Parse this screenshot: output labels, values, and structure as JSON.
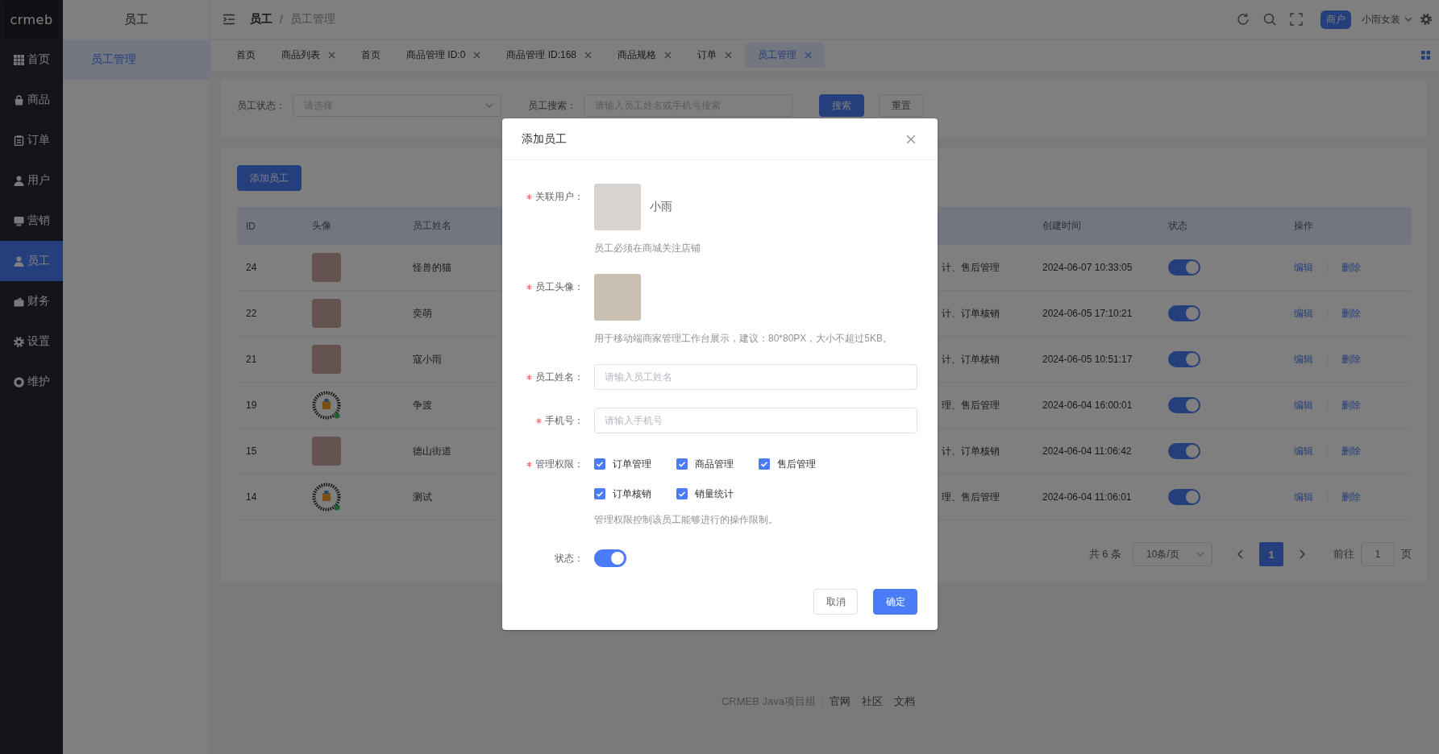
{
  "sidebar": {
    "logo": "crmeb",
    "items": [
      {
        "label": "首页",
        "selected": false
      },
      {
        "label": "商品",
        "selected": false
      },
      {
        "label": "订单",
        "selected": false
      },
      {
        "label": "用户",
        "selected": false
      },
      {
        "label": "营销",
        "selected": false
      },
      {
        "label": "员工",
        "selected": true
      },
      {
        "label": "财务",
        "selected": false
      },
      {
        "label": "设置",
        "selected": false
      },
      {
        "label": "维护",
        "selected": false
      }
    ]
  },
  "submenu": {
    "title": "员工",
    "items": [
      {
        "label": "员工管理",
        "selected": true
      }
    ]
  },
  "header": {
    "breadcrumb": [
      "员工",
      "员工管理"
    ],
    "separator": "/",
    "badge": "商户",
    "user": "小雨女装"
  },
  "tabs": [
    {
      "label": "首页",
      "closable": false,
      "selected": false
    },
    {
      "label": "商品列表",
      "closable": true,
      "selected": false
    },
    {
      "label": "首页",
      "closable": false,
      "selected": false
    },
    {
      "label": "商品管理 ID:0",
      "closable": true,
      "selected": false
    },
    {
      "label": "商品管理 ID:168",
      "closable": true,
      "selected": false
    },
    {
      "label": "商品规格",
      "closable": true,
      "selected": false
    },
    {
      "label": "订单",
      "closable": true,
      "selected": false
    },
    {
      "label": "员工管理",
      "closable": true,
      "selected": true
    }
  ],
  "filter": {
    "fields": [
      {
        "kind": "select",
        "label": "员工状态：",
        "placeholder": "请选择"
      },
      {
        "kind": "input",
        "label": "员工搜索：",
        "placeholder": "请输入员工姓名或手机号搜索"
      }
    ],
    "buttons": [
      {
        "kind": "primary",
        "label": "搜索"
      },
      {
        "kind": "plain",
        "label": "重置"
      }
    ]
  },
  "table": {
    "add_button": "添加员工",
    "columns": [
      "ID",
      "头像",
      "员工姓名",
      "创建时间",
      "状态",
      "操作"
    ],
    "rows": [
      {
        "id": "24",
        "avatar": {
          "kind": "photo"
        },
        "name": "怪兽的猫",
        "column_4": "计、售后管理",
        "created": "2024-06-07 10:33:05",
        "on": true,
        "actions": [
          "编辑",
          "删除"
        ]
      },
      {
        "id": "22",
        "avatar": {
          "kind": "photo"
        },
        "name": "奕萌",
        "column_4": "计、订单核销",
        "created": "2024-06-05 17:10:21",
        "on": true,
        "actions": [
          "编辑",
          "删除"
        ]
      },
      {
        "id": "21",
        "avatar": {
          "kind": "photo"
        },
        "name": "寇小雨",
        "column_4": "计、订单核销",
        "created": "2024-06-05 10:51:17",
        "on": true,
        "actions": [
          "编辑",
          "删除"
        ]
      },
      {
        "id": "19",
        "avatar": {
          "kind": "code"
        },
        "name": "争渡",
        "column_4": "理、售后管理",
        "created": "2024-06-04 16:00:01",
        "on": true,
        "actions": [
          "编辑",
          "删除"
        ]
      },
      {
        "id": "15",
        "avatar": {
          "kind": "photo"
        },
        "name": "德山街道",
        "column_4": "计、订单核销",
        "created": "2024-06-04 11:06:42",
        "on": true,
        "actions": [
          "编辑",
          "删除"
        ]
      },
      {
        "id": "14",
        "avatar": {
          "kind": "code"
        },
        "name": "测试",
        "column_4": "理、售后管理",
        "created": "2024-06-04 11:06:01",
        "on": true,
        "actions": [
          "编辑",
          "删除"
        ]
      }
    ]
  },
  "pagination": {
    "total": "共 6 条",
    "page_size": "10条/页",
    "pages": [
      {
        "label": "1",
        "selected": true
      }
    ],
    "goto_label": "前往",
    "goto_value": "1",
    "goto_suffix": "页"
  },
  "footer": {
    "text": "CRMEB Java项目组",
    "links": [
      "官网",
      "社区",
      "文档"
    ]
  },
  "dialog": {
    "title": "添加员工",
    "fields": [
      {
        "kind": "user",
        "label": "关联用户：",
        "required": true,
        "name": "小雨",
        "help": "员工必须在商城关注店铺"
      },
      {
        "kind": "image",
        "label": "员工头像：",
        "required": true,
        "help": "用于移动端商家管理工作台展示，建议：80*80PX，大小不超过5KB。"
      },
      {
        "kind": "input",
        "label": "员工姓名：",
        "required": true,
        "placeholder": "请输入员工姓名"
      },
      {
        "kind": "input",
        "label": "手机号：",
        "required": true,
        "placeholder": "请输入手机号"
      },
      {
        "kind": "checkboxes",
        "label": "管理权限：",
        "required": true,
        "options": [
          {
            "label": "订单管理",
            "checked": true
          },
          {
            "label": "商品管理",
            "checked": true
          },
          {
            "label": "售后管理",
            "checked": true
          },
          {
            "label": "订单核销",
            "checked": true
          },
          {
            "label": "销量统计",
            "checked": true
          }
        ],
        "help": "管理权限控制该员工能够进行的操作限制。"
      },
      {
        "kind": "switch",
        "label": "状态：",
        "required": false,
        "on": true
      }
    ],
    "buttons": [
      {
        "kind": "plain",
        "label": "取消"
      },
      {
        "kind": "primary",
        "label": "确定"
      }
    ]
  }
}
